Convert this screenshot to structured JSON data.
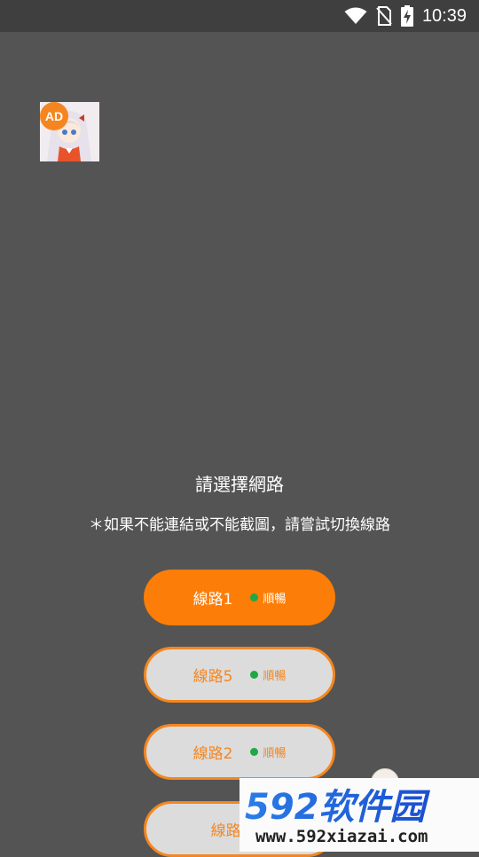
{
  "status_bar": {
    "time": "10:39",
    "icons": [
      "wifi-icon",
      "no-sim-icon",
      "battery-charging-icon"
    ]
  },
  "ad": {
    "badge": "AD",
    "image": "anime-girl-thumbnail"
  },
  "header": {
    "title": "請選擇網路",
    "hint": "＊如果不能連結或不能截圖，請嘗試切換線路"
  },
  "routes": [
    {
      "label": "線路1",
      "status": "順暢",
      "selected": true
    },
    {
      "label": "線路5",
      "status": "順暢",
      "selected": false
    },
    {
      "label": "線路2",
      "status": "順暢",
      "selected": false
    },
    {
      "label": "線路3",
      "status": "",
      "selected": false
    }
  ],
  "watermark": {
    "brand": "592软件园",
    "url": "www.592xiazai.com"
  },
  "colors": {
    "background": "#545454",
    "accent": "#fc7d08",
    "status_ok": "#1fa845"
  }
}
